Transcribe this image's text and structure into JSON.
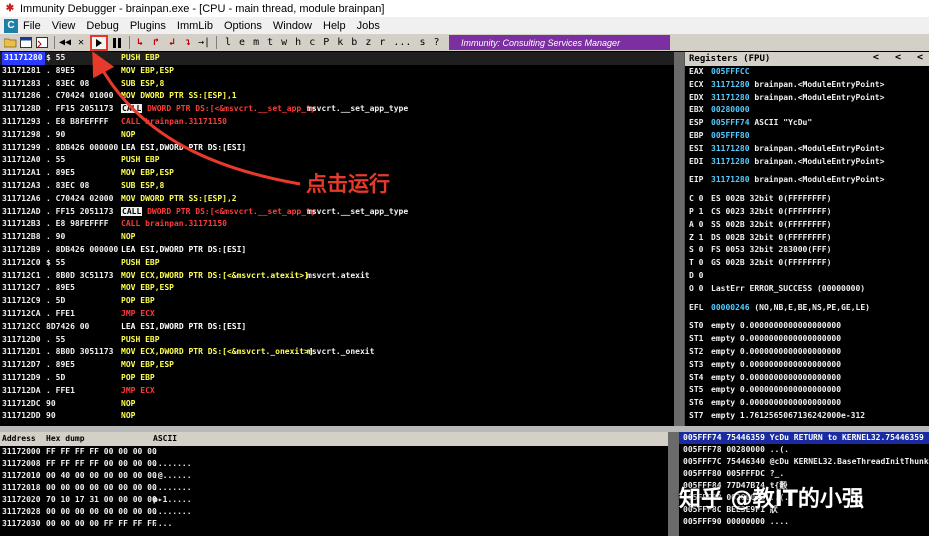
{
  "window": {
    "title": "Immunity Debugger - brainpan.exe - [CPU - main thread, module brainpan]"
  },
  "menu": {
    "app_icon": "C",
    "items": [
      "File",
      "View",
      "Debug",
      "Plugins",
      "ImmLib",
      "Options",
      "Window",
      "Help",
      "Jobs"
    ]
  },
  "toolbar": {
    "rewind": "◀◀",
    "close": "✕",
    "run_icon": "play-icon",
    "red_buttons": [
      "↳",
      "↱",
      "↲",
      "↴",
      "→|"
    ],
    "letters": [
      "l",
      "e",
      "m",
      "t",
      "w",
      "h",
      "c",
      "P",
      "k",
      "b",
      "z",
      "r",
      "...",
      "s",
      "?"
    ],
    "banner": "Immunity: Consulting Services Manager"
  },
  "annotation": {
    "text": "点击运行",
    "accent": "#e83a2a"
  },
  "cpu": {
    "rows": [
      {
        "addr": "31171280",
        "hex": "$ 55",
        "op": "PUSH",
        "arg": "EBP",
        "cls": "k-push",
        "comment": "",
        "sel": true
      },
      {
        "addr": "31171281",
        "hex": ". 89E5",
        "op": "MOV",
        "arg": "EBP,ESP",
        "cls": "k-mov",
        "comment": ""
      },
      {
        "addr": "31171283",
        "hex": ". 83EC 08",
        "op": "SUB",
        "arg": "ESP,8",
        "cls": "k-sub",
        "comment": ""
      },
      {
        "addr": "31171286",
        "hex": ". C70424 01000",
        "op": "MOV",
        "arg": "DWORD PTR SS:[ESP],1",
        "cls": "k-mov",
        "comment": ""
      },
      {
        "addr": "3117128D",
        "hex": ". FF15 2051173",
        "op": "CALL",
        "arg": "DWORD PTR DS:[<&msvcrt.__set_app_ty",
        "cls": "k-call",
        "comment": "msvcrt.__set_app_type",
        "box": true
      },
      {
        "addr": "31171293",
        "hex": ". E8 B8FEFFFF",
        "op": "CALL",
        "arg": "brainpan.31171150",
        "cls": "k-call",
        "comment": ""
      },
      {
        "addr": "31171298",
        "hex": ". 90",
        "op": "NOP",
        "arg": "",
        "cls": "k-nop",
        "comment": ""
      },
      {
        "addr": "31171299",
        "hex": ". 8DB426 000000",
        "op": "LEA",
        "arg": "ESI,DWORD PTR DS:[ESI]",
        "cls": "k-lea",
        "comment": ""
      },
      {
        "addr": "311712A0",
        "hex": ". 55",
        "op": "PUSH",
        "arg": "EBP",
        "cls": "k-push",
        "comment": ""
      },
      {
        "addr": "311712A1",
        "hex": ". 89E5",
        "op": "MOV",
        "arg": "EBP,ESP",
        "cls": "k-mov",
        "comment": ""
      },
      {
        "addr": "311712A3",
        "hex": ". 83EC 08",
        "op": "SUB",
        "arg": "ESP,8",
        "cls": "k-sub",
        "comment": ""
      },
      {
        "addr": "311712A6",
        "hex": ". C70424 02000",
        "op": "MOV",
        "arg": "DWORD PTR SS:[ESP],2",
        "cls": "k-mov",
        "comment": ""
      },
      {
        "addr": "311712AD",
        "hex": ". FF15 2051173",
        "op": "CALL",
        "arg": "DWORD PTR DS:[<&msvcrt.__set_app_ty",
        "cls": "k-call",
        "comment": "msvcrt.__set_app_type",
        "box": true
      },
      {
        "addr": "311712B3",
        "hex": ". E8 98FEFFFF",
        "op": "CALL",
        "arg": "brainpan.31171150",
        "cls": "k-call",
        "comment": ""
      },
      {
        "addr": "311712B8",
        "hex": ". 90",
        "op": "NOP",
        "arg": "",
        "cls": "k-nop",
        "comment": ""
      },
      {
        "addr": "311712B9",
        "hex": ". 8DB426 000000",
        "op": "LEA",
        "arg": "ESI,DWORD PTR DS:[ESI]",
        "cls": "k-lea",
        "comment": ""
      },
      {
        "addr": "311712C0",
        "hex": "$ 55",
        "op": "PUSH",
        "arg": "EBP",
        "cls": "k-push",
        "comment": ""
      },
      {
        "addr": "311712C1",
        "hex": ". 8B0D 3C51173",
        "op": "MOV",
        "arg": "ECX,DWORD PTR DS:[<&msvcrt.atexit>]",
        "cls": "k-mov",
        "comment": "msvcrt.atexit"
      },
      {
        "addr": "311712C7",
        "hex": ". 89E5",
        "op": "MOV",
        "arg": "EBP,ESP",
        "cls": "k-mov",
        "comment": ""
      },
      {
        "addr": "311712C9",
        "hex": ". 5D",
        "op": "POP",
        "arg": "EBP",
        "cls": "k-pop",
        "comment": ""
      },
      {
        "addr": "311712CA",
        "hex": ". FFE1",
        "op": "JMP",
        "arg": "ECX",
        "cls": "k-jmp",
        "comment": ""
      },
      {
        "addr": "311712CC",
        "hex": "  8D7426 00",
        "op": "LEA",
        "arg": "ESI,DWORD PTR DS:[ESI]",
        "cls": "k-lea",
        "comment": ""
      },
      {
        "addr": "311712D0",
        "hex": ". 55",
        "op": "PUSH",
        "arg": "EBP",
        "cls": "k-push",
        "comment": ""
      },
      {
        "addr": "311712D1",
        "hex": ". 8B0D 3051173",
        "op": "MOV",
        "arg": "ECX,DWORD PTR DS:[<&msvcrt._onexit>]",
        "cls": "k-mov",
        "comment": "msvcrt._onexit"
      },
      {
        "addr": "311712D7",
        "hex": ". 89E5",
        "op": "MOV",
        "arg": "EBP,ESP",
        "cls": "k-mov",
        "comment": ""
      },
      {
        "addr": "311712D9",
        "hex": ". 5D",
        "op": "POP",
        "arg": "EBP",
        "cls": "k-pop",
        "comment": ""
      },
      {
        "addr": "311712DA",
        "hex": ". FFE1",
        "op": "JMP",
        "arg": "ECX",
        "cls": "k-jmp",
        "comment": ""
      },
      {
        "addr": "311712DC",
        "hex": "  90",
        "op": "NOP",
        "arg": "",
        "cls": "k-nop",
        "comment": ""
      },
      {
        "addr": "311712DD",
        "hex": "  90",
        "op": "NOP",
        "arg": "",
        "cls": "k-nop",
        "comment": ""
      }
    ]
  },
  "registers": {
    "header": "Registers (FPU)",
    "arrows": [
      "<",
      "<",
      "<"
    ],
    "groups": [
      [
        {
          "name": "EAX",
          "value": "005FFFCC",
          "desc": ""
        },
        {
          "name": "ECX",
          "value": "31171280",
          "desc": "brainpan.<ModuleEntryPoint>"
        },
        {
          "name": "EDX",
          "value": "31171280",
          "desc": "brainpan.<ModuleEntryPoint>"
        },
        {
          "name": "EBX",
          "value": "00280000",
          "desc": ""
        },
        {
          "name": "ESP",
          "value": "005FFF74",
          "desc": "ASCII \"YcDu\""
        },
        {
          "name": "EBP",
          "value": "005FFF80",
          "desc": ""
        },
        {
          "name": "ESI",
          "value": "31171280",
          "desc": "brainpan.<ModuleEntryPoint>"
        },
        {
          "name": "EDI",
          "value": "31171280",
          "desc": "brainpan.<ModuleEntryPoint>"
        }
      ],
      [
        {
          "name": "EIP",
          "value": "31171280",
          "desc": "brainpan.<ModuleEntryPoint>"
        }
      ],
      [
        {
          "name": "C 0",
          "value": "",
          "desc": "ES 002B 32bit 0(FFFFFFFF)"
        },
        {
          "name": "P 1",
          "value": "",
          "desc": "CS 0023 32bit 0(FFFFFFFF)"
        },
        {
          "name": "A 0",
          "value": "",
          "desc": "SS 002B 32bit 0(FFFFFFFF)"
        },
        {
          "name": "Z 1",
          "value": "",
          "desc": "DS 002B 32bit 0(FFFFFFFF)"
        },
        {
          "name": "S 0",
          "value": "",
          "desc": "FS 0053 32bit 283000(FFF)"
        },
        {
          "name": "T 0",
          "value": "",
          "desc": "GS 002B 32bit 0(FFFFFFFF)"
        },
        {
          "name": "D 0",
          "value": "",
          "desc": ""
        },
        {
          "name": "O 0",
          "value": "",
          "desc": "LastErr ERROR_SUCCESS (00000000)"
        }
      ],
      [
        {
          "name": "EFL",
          "value": "00000246",
          "desc": "(NO,NB,E,BE,NS,PE,GE,LE)"
        }
      ],
      [
        {
          "name": "ST0",
          "value": "",
          "desc": "empty 0.0000000000000000000"
        },
        {
          "name": "ST1",
          "value": "",
          "desc": "empty 0.0000000000000000000"
        },
        {
          "name": "ST2",
          "value": "",
          "desc": "empty 0.0000000000000000000"
        },
        {
          "name": "ST3",
          "value": "",
          "desc": "empty 0.0000000000000000000"
        },
        {
          "name": "ST4",
          "value": "",
          "desc": "empty 0.0000000000000000000"
        },
        {
          "name": "ST5",
          "value": "",
          "desc": "empty 0.0000000000000000000"
        },
        {
          "name": "ST6",
          "value": "",
          "desc": "empty 0.0000000000000000000"
        },
        {
          "name": "ST7",
          "value": "",
          "desc": "empty 1.7612565067136242000e-312"
        }
      ]
    ]
  },
  "dump": {
    "headers": [
      "Address",
      "Hex dump",
      "ASCII"
    ],
    "rows": [
      {
        "addr": "31172000",
        "hex": "FF FF FF FF 00 00 00 00",
        "ascii": "      ."
      },
      {
        "addr": "31172008",
        "hex": "FF FF FF FF 00 00 00 00",
        "ascii": "........"
      },
      {
        "addr": "31172010",
        "hex": "00 40 00 00 00 00 00 00",
        "ascii": ".@......"
      },
      {
        "addr": "31172018",
        "hex": "00 00 00 00 00 00 00 00",
        "ascii": "........"
      },
      {
        "addr": "31172020",
        "hex": "70 10 17 31 00 00 00 00",
        "ascii": "p▸1....."
      },
      {
        "addr": "31172028",
        "hex": "00 00 00 00 00 00 00 00",
        "ascii": "........"
      },
      {
        "addr": "31172030",
        "hex": "00 00 00 00 FF FF FF FF",
        "ascii": "....    "
      }
    ]
  },
  "stack": {
    "rows": [
      {
        "text": "005FFF74  75446359  YcDu  RETURN to KERNEL32.75446359",
        "sel": true
      },
      {
        "text": "005FFF78  00280000  ..(."
      },
      {
        "text": "005FFF7C  75446340  @cDu  KERNEL32.BaseThreadInitThunk"
      },
      {
        "text": "005FFF80  005FFFDC  ?_."
      },
      {
        "text": "005FFF84  77D47B74  t{觳"
      },
      {
        "text": "005FFF88  00280000  ..(."
      },
      {
        "text": "005FFF8C  BEE3E9F1  狀"
      },
      {
        "text": "005FFF90  00000000  ...."
      }
    ]
  },
  "watermark": {
    "text": "知乎 @教IT的小强"
  }
}
